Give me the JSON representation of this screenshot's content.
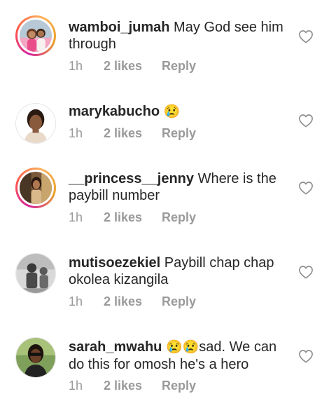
{
  "comments": [
    {
      "username": "wamboi_jumah",
      "body": "May God see him through",
      "time": "1h",
      "likes": "2 likes",
      "reply": "Reply",
      "emoji": ""
    },
    {
      "username": "marykabucho",
      "body": "",
      "time": "1h",
      "likes": "2 likes",
      "reply": "Reply",
      "emoji": "😢"
    },
    {
      "username": "__princess__jenny",
      "body": "Where is the paybill number",
      "time": "1h",
      "likes": "2 likes",
      "reply": "Reply",
      "emoji": ""
    },
    {
      "username": "mutisoezekiel",
      "body": "Paybill chap chap okolea kizangila",
      "time": "1h",
      "likes": "2 likes",
      "reply": "Reply",
      "emoji": ""
    },
    {
      "username": "sarah_mwahu",
      "body": "sad. We can do this for omosh he's a hero",
      "time": "1h",
      "likes": "2 likes",
      "reply": "Reply",
      "emoji": "😢😢"
    }
  ],
  "colors": {
    "text": "#262626",
    "meta": "#9a9a9a",
    "heart": "#8e8e8e"
  }
}
